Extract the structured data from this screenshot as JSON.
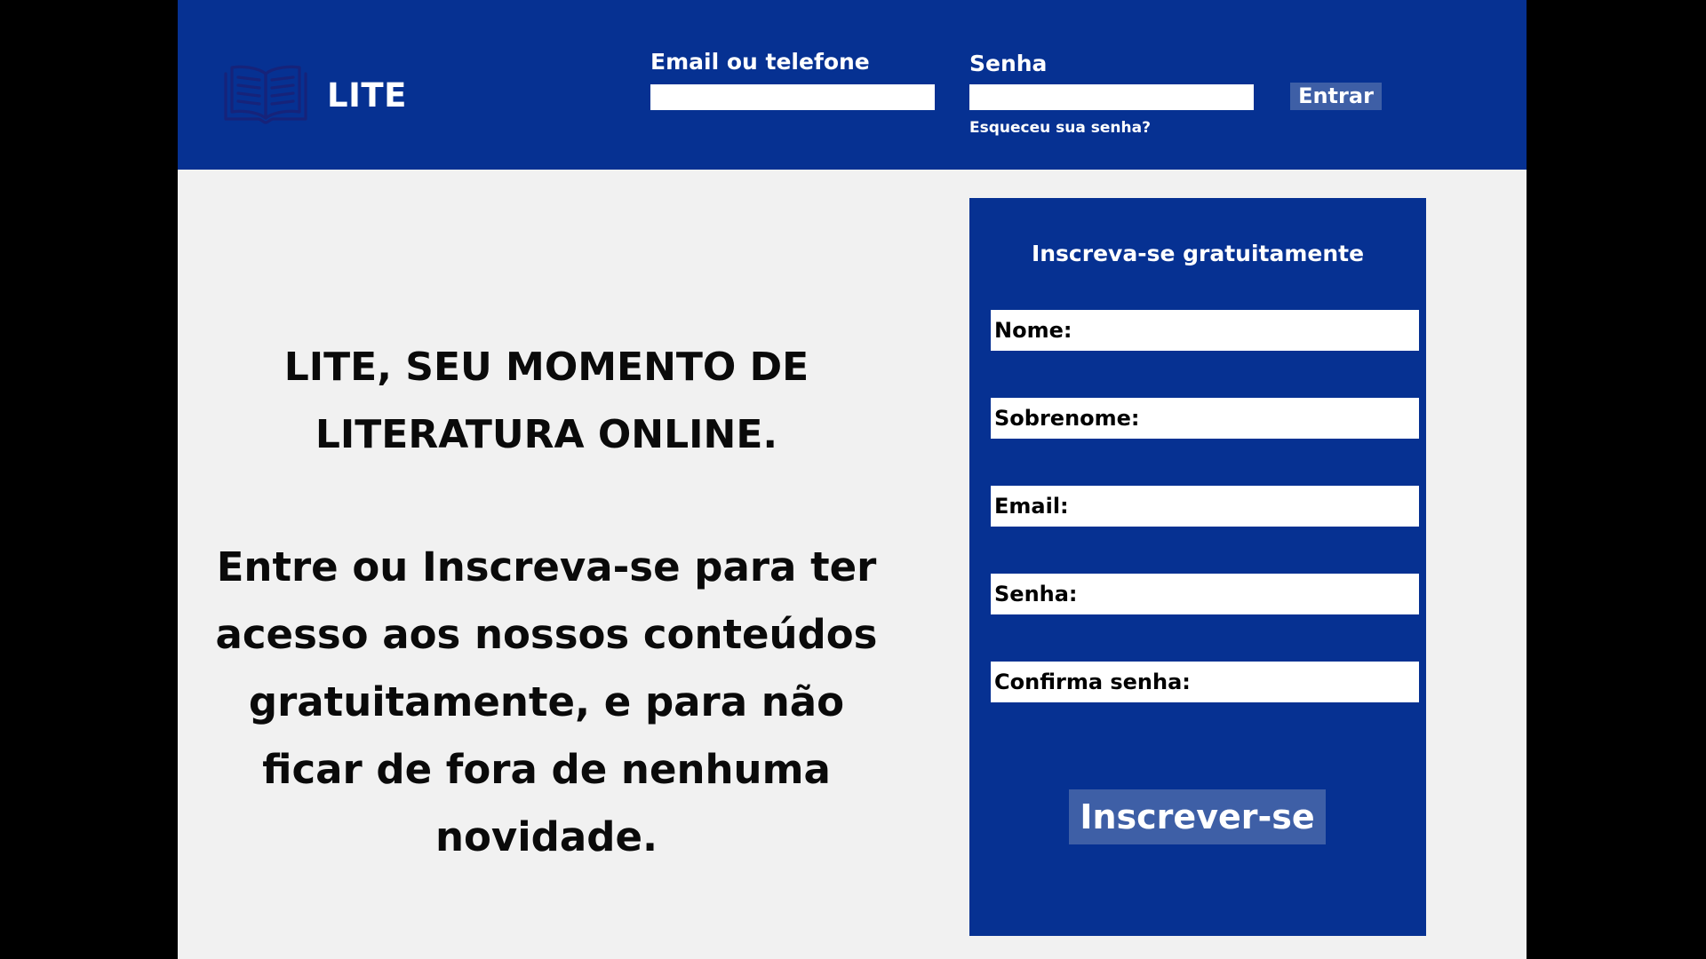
{
  "header": {
    "brand": "LITE",
    "email_label": "Email ou telefone",
    "email_value": "",
    "password_label": "Senha",
    "password_value": "",
    "login_button": "Entrar",
    "forgot_password": "Esqueceu sua senha?",
    "logo_icon": "open-book-icon"
  },
  "main": {
    "tagline_line1": "LITE, SEU MOMENTO DE",
    "tagline_line2": "LITERATURA ONLINE.",
    "promo_lines": [
      "Entre ou Inscreva-se para ter",
      "acesso aos nossos conteúdos",
      "gratuitamente, e para não",
      "ficar de fora de nenhuma",
      "novidade."
    ]
  },
  "signup": {
    "title": "Inscreva-se gratuitamente",
    "fields": [
      {
        "label": "Nome:"
      },
      {
        "label": "Sobrenome:"
      },
      {
        "label": "Email:"
      },
      {
        "label": "Senha:"
      },
      {
        "label": "Confirma senha:"
      }
    ],
    "submit_button": "Inscrever-se"
  },
  "colors": {
    "primary_blue": "#063192",
    "button_blue": "#3e5fa6",
    "page_background": "#f1f1f1",
    "outer_background": "#000000"
  }
}
